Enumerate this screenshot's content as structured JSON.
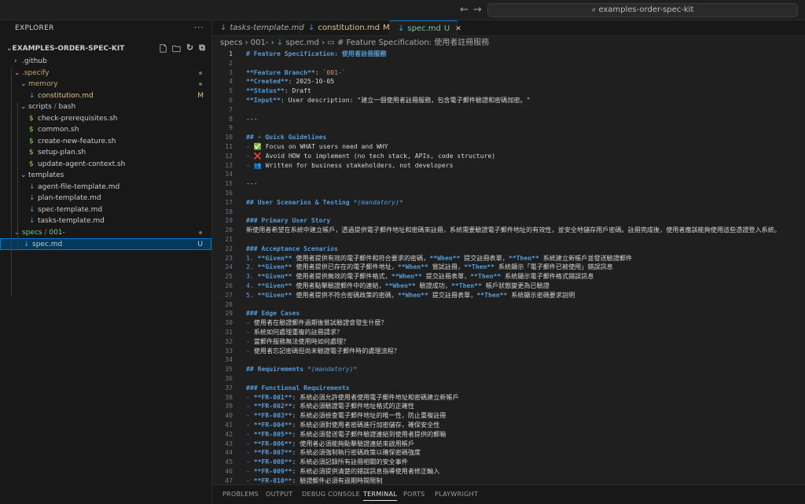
{
  "titlebar": {
    "search_text": "examples-order-spec-kit",
    "back_icon": "arrow-left-icon",
    "forward_icon": "arrow-right-icon"
  },
  "sidebar": {
    "header": "EXPLORER",
    "project": "EXAMPLES-ORDER-SPEC-KIT",
    "tree": [
      {
        "label": ".github",
        "depth": 1,
        "type": "folder",
        "open": false,
        "color": "#cccccc"
      },
      {
        "label": ".specify",
        "depth": 1,
        "type": "folder",
        "open": true,
        "color": "#c5a572",
        "dot": true
      },
      {
        "label": "memory",
        "depth": 2,
        "type": "folder",
        "open": true,
        "color": "#c5a572",
        "dot": true
      },
      {
        "label": "constitution.md",
        "depth": 3,
        "type": "md",
        "color": "#e2c08d",
        "badge": "M"
      },
      {
        "label": "scripts",
        "label2": "bash",
        "depth": 2,
        "type": "folder",
        "open": true,
        "color": "#cccccc"
      },
      {
        "label": "check-prerequisites.sh",
        "depth": 3,
        "type": "sh",
        "color": "#cccccc"
      },
      {
        "label": "common.sh",
        "depth": 3,
        "type": "sh",
        "color": "#cccccc"
      },
      {
        "label": "create-new-feature.sh",
        "depth": 3,
        "type": "sh",
        "color": "#cccccc"
      },
      {
        "label": "setup-plan.sh",
        "depth": 3,
        "type": "sh",
        "color": "#cccccc"
      },
      {
        "label": "update-agent-context.sh",
        "depth": 3,
        "type": "sh",
        "color": "#cccccc"
      },
      {
        "label": "templates",
        "depth": 2,
        "type": "folder",
        "open": true,
        "color": "#cccccc"
      },
      {
        "label": "agent-file-template.md",
        "depth": 3,
        "type": "md",
        "color": "#cccccc"
      },
      {
        "label": "plan-template.md",
        "depth": 3,
        "type": "md",
        "color": "#cccccc"
      },
      {
        "label": "spec-template.md",
        "depth": 3,
        "type": "md",
        "color": "#cccccc"
      },
      {
        "label": "tasks-template.md",
        "depth": 3,
        "type": "md",
        "color": "#cccccc"
      },
      {
        "label": "specs",
        "label2": "001-",
        "depth": 1,
        "type": "folder",
        "open": true,
        "color": "#73c991",
        "dot": true
      },
      {
        "label": "spec.md",
        "depth": 2,
        "type": "md",
        "color": "#cccccc",
        "badge": "U",
        "selected": true
      }
    ]
  },
  "tabs": [
    {
      "label": "tasks-template.md",
      "italic": true,
      "color": "#a9a9a9"
    },
    {
      "label": "constitution.md",
      "badge": "M",
      "color": "#e2c08d"
    },
    {
      "label": "spec.md",
      "badge": "U",
      "color": "#73c991",
      "active": true
    }
  ],
  "breadcrumb": {
    "a": "specs",
    "b": "001-",
    "c": "spec.md",
    "d": "# Feature Specification: 使用者註冊服務"
  },
  "editor": {
    "lines": [
      [
        {
          "c": "h",
          "t": "# Feature Specification: 使用者註冊服務"
        }
      ],
      [],
      [
        {
          "c": "b",
          "t": "**Feature Branch**"
        },
        {
          "t": ": "
        },
        {
          "c": "code",
          "t": "`001-`"
        }
      ],
      [
        {
          "c": "b",
          "t": "**Created**"
        },
        {
          "t": ": 2025-10-05"
        }
      ],
      [
        {
          "c": "b",
          "t": "**Status**"
        },
        {
          "t": ": Draft"
        }
      ],
      [
        {
          "c": "b",
          "t": "**Input**"
        },
        {
          "t": ": User description: \"建立一個使用者註冊服務，包含電子郵件驗證和密碼加密。\""
        }
      ],
      [],
      [
        {
          "t": "---"
        }
      ],
      [],
      [
        {
          "c": "h",
          "t": "## ⚡ Quick Guidelines"
        }
      ],
      [
        {
          "c": "mk",
          "t": "- "
        },
        {
          "t": "✅ Focus on WHAT users need and WHY"
        }
      ],
      [
        {
          "c": "mk",
          "t": "- "
        },
        {
          "t": "❌ Avoid HOW to implement (no tech stack, APIs, code structure)"
        }
      ],
      [
        {
          "c": "mk",
          "t": "- "
        },
        {
          "t": "👥 Written for business stakeholders, not developers"
        }
      ],
      [],
      [
        {
          "t": "---"
        }
      ],
      [],
      [
        {
          "c": "h",
          "t": "## User Scenarios & Testing "
        },
        {
          "c": "it",
          "t": "*(mandatory)*"
        }
      ],
      [],
      [
        {
          "c": "h",
          "t": "### Primary User Story"
        }
      ],
      [
        {
          "t": "新使用者希望在系統中建立帳戶，透過提供電子郵件地址和密碼來註冊，系統需要驗證電子郵件地址的有效性，並安全地儲存用戶密碼。註冊完成後，使用者應該能夠使用這些憑證登入系統。"
        }
      ],
      [],
      [
        {
          "c": "h",
          "t": "### Acceptance Scenarios"
        }
      ],
      [
        {
          "c": "mk",
          "t": "1. "
        },
        {
          "c": "b",
          "t": "**Given**"
        },
        {
          "t": " 使用者提供有效的電子郵件和符合要求的密碼，"
        },
        {
          "c": "b",
          "t": "**When**"
        },
        {
          "t": " 提交註冊表單，"
        },
        {
          "c": "b",
          "t": "**Then**"
        },
        {
          "t": " 系統建立新帳戶並發送驗證郵件"
        }
      ],
      [
        {
          "c": "mk",
          "t": "2. "
        },
        {
          "c": "b",
          "t": "**Given**"
        },
        {
          "t": " 使用者提供已存在的電子郵件地址，"
        },
        {
          "c": "b",
          "t": "**When**"
        },
        {
          "t": " 嘗試註冊，"
        },
        {
          "c": "b",
          "t": "**Then**"
        },
        {
          "t": " 系統顯示「電子郵件已被使用」錯誤訊息"
        }
      ],
      [
        {
          "c": "mk",
          "t": "3. "
        },
        {
          "c": "b",
          "t": "**Given**"
        },
        {
          "t": " 使用者提供無效的電子郵件格式，"
        },
        {
          "c": "b",
          "t": "**When**"
        },
        {
          "t": " 提交註冊表單，"
        },
        {
          "c": "b",
          "t": "**Then**"
        },
        {
          "t": " 系統顯示電子郵件格式錯誤訊息"
        }
      ],
      [
        {
          "c": "mk",
          "t": "4. "
        },
        {
          "c": "b",
          "t": "**Given**"
        },
        {
          "t": " 使用者點擊驗證郵件中的連結，"
        },
        {
          "c": "b",
          "t": "**When**"
        },
        {
          "t": " 驗證成功，"
        },
        {
          "c": "b",
          "t": "**Then**"
        },
        {
          "t": " 帳戶狀態變更為已驗證"
        }
      ],
      [
        {
          "c": "mk",
          "t": "5. "
        },
        {
          "c": "b",
          "t": "**Given**"
        },
        {
          "t": " 使用者提供不符合密碼政策的密碼，"
        },
        {
          "c": "b",
          "t": "**When**"
        },
        {
          "t": " 提交註冊表單，"
        },
        {
          "c": "b",
          "t": "**Then**"
        },
        {
          "t": " 系統顯示密碼要求說明"
        }
      ],
      [],
      [
        {
          "c": "h",
          "t": "### Edge Cases"
        }
      ],
      [
        {
          "c": "mk",
          "t": "- "
        },
        {
          "t": "使用者在驗證郵件過期後嘗試驗證會發生什麼？"
        }
      ],
      [
        {
          "c": "mk",
          "t": "- "
        },
        {
          "t": "系統如何處理重複的註冊請求？"
        }
      ],
      [
        {
          "c": "mk",
          "t": "- "
        },
        {
          "t": "當郵件服務無法使用時如何處理？"
        }
      ],
      [
        {
          "c": "mk",
          "t": "- "
        },
        {
          "t": "使用者忘記密碼但尚未驗證電子郵件時的處理流程？"
        }
      ],
      [],
      [
        {
          "c": "h",
          "t": "## Requirements "
        },
        {
          "c": "it",
          "t": "*(mandatory)*"
        }
      ],
      [],
      [
        {
          "c": "h",
          "t": "### Functional Requirements"
        }
      ],
      [
        {
          "c": "mk",
          "t": "- "
        },
        {
          "c": "b",
          "t": "**FR-001**"
        },
        {
          "t": ": 系統必須允許使用者使用電子郵件地址和密碼建立新帳戶"
        }
      ],
      [
        {
          "c": "mk",
          "t": "- "
        },
        {
          "c": "b",
          "t": "**FR-002**"
        },
        {
          "t": ": 系統必須驗證電子郵件地址格式的正確性"
        }
      ],
      [
        {
          "c": "mk",
          "t": "- "
        },
        {
          "c": "b",
          "t": "**FR-003**"
        },
        {
          "t": ": 系統必須檢查電子郵件地址的唯一性，防止重複註冊"
        }
      ],
      [
        {
          "c": "mk",
          "t": "- "
        },
        {
          "c": "b",
          "t": "**FR-004**"
        },
        {
          "t": ": 系統必須對使用者密碼進行加密儲存，確保安全性"
        }
      ],
      [
        {
          "c": "mk",
          "t": "- "
        },
        {
          "c": "b",
          "t": "**FR-005**"
        },
        {
          "t": ": 系統必須發送電子郵件驗證連結到使用者提供的郵箱"
        }
      ],
      [
        {
          "c": "mk",
          "t": "- "
        },
        {
          "c": "b",
          "t": "**FR-006**"
        },
        {
          "t": ": 使用者必須能夠點擊驗證連結來啟用帳戶"
        }
      ],
      [
        {
          "c": "mk",
          "t": "- "
        },
        {
          "c": "b",
          "t": "**FR-007**"
        },
        {
          "t": ": 系統必須強制執行密碼政策以確保密碼強度"
        }
      ],
      [
        {
          "c": "mk",
          "t": "- "
        },
        {
          "c": "b",
          "t": "**FR-008**"
        },
        {
          "t": ": 系統必須記錄所有註冊相關的安全事件"
        }
      ],
      [
        {
          "c": "mk",
          "t": "- "
        },
        {
          "c": "b",
          "t": "**FR-009**"
        },
        {
          "t": ": 系統必須提供清楚的錯誤訊息指導使用者修正輸入"
        }
      ],
      [
        {
          "c": "mk",
          "t": "- "
        },
        {
          "c": "b",
          "t": "**FR-010**"
        },
        {
          "t": ": 驗證郵件必須有過期時間限制"
        }
      ]
    ]
  },
  "panel": {
    "tabs": [
      "PROBLEMS",
      "OUTPUT",
      "DEBUG CONSOLE",
      "TERMINAL",
      "PORTS",
      "PLAYWRIGHT"
    ],
    "active": 3
  }
}
